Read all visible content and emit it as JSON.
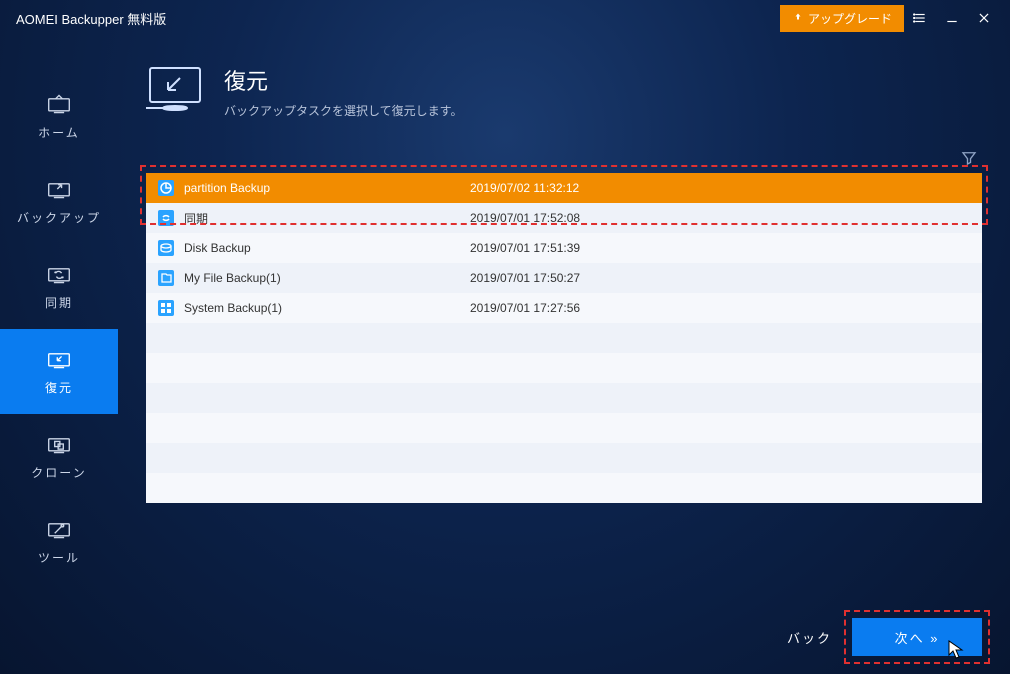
{
  "titlebar": {
    "title": "AOMEI Backupper 無料版",
    "upgrade": "アップグレード"
  },
  "sidebar": {
    "items": [
      {
        "label": "ホーム"
      },
      {
        "label": "バックアップ"
      },
      {
        "label": "同期"
      },
      {
        "label": "復元"
      },
      {
        "label": "クローン"
      },
      {
        "label": "ツール"
      }
    ]
  },
  "header": {
    "title": "復元",
    "subtitle": "バックアップタスクを選択して復元します。"
  },
  "tasks": [
    {
      "name": "partition Backup",
      "date": "2019/07/02 11:32:12",
      "icon": "partition",
      "selected": true
    },
    {
      "name": "同期",
      "date": "2019/07/01 17:52:08",
      "icon": "sync"
    },
    {
      "name": "Disk Backup",
      "date": "2019/07/01 17:51:39",
      "icon": "disk"
    },
    {
      "name": "My File Backup(1)",
      "date": "2019/07/01 17:50:27",
      "icon": "file"
    },
    {
      "name": "System Backup(1)",
      "date": "2019/07/01 17:27:56",
      "icon": "system"
    }
  ],
  "footer": {
    "back": "バック",
    "next": "次へ »"
  },
  "colors": {
    "accent": "#0a7cf0",
    "orange": "#f28c00",
    "dash": "#e03030"
  }
}
